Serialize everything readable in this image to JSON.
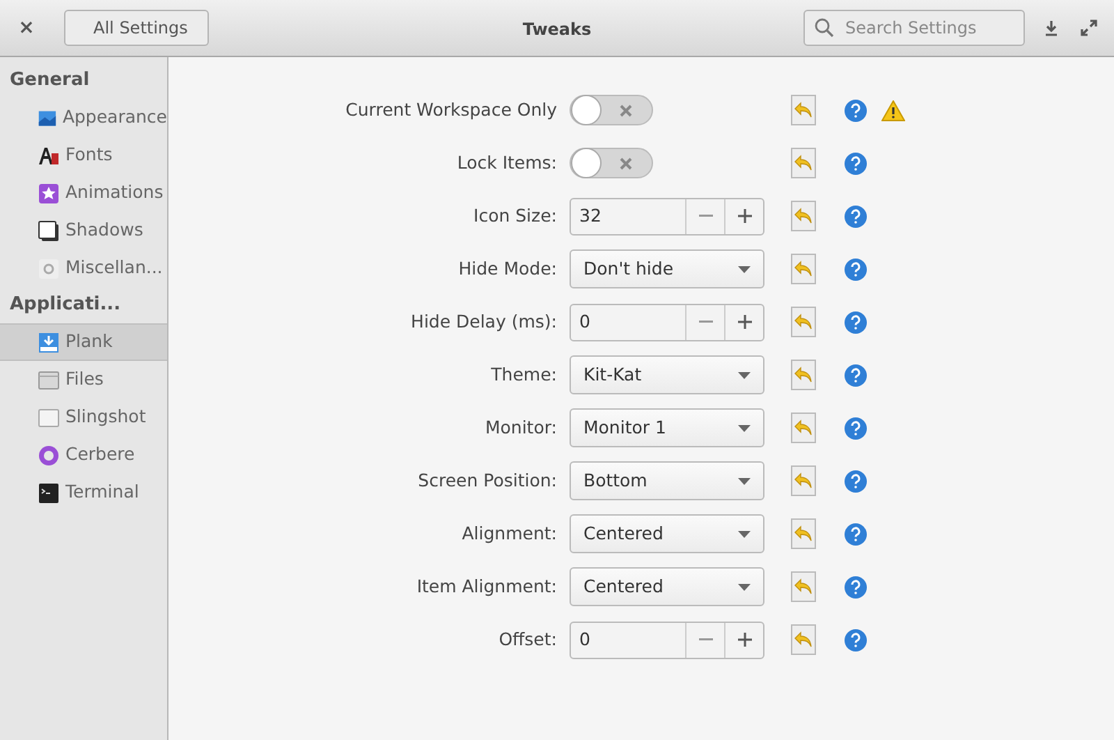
{
  "window": {
    "title": "Tweaks",
    "back_button": "All Settings",
    "close": "×",
    "search": {
      "placeholder": "Search Settings"
    }
  },
  "sidebar": {
    "sections": [
      {
        "heading": "General",
        "items": [
          {
            "label": "Appearance",
            "selected": false
          },
          {
            "label": "Fonts",
            "selected": false
          },
          {
            "label": "Animations",
            "selected": false
          },
          {
            "label": "Shadows",
            "selected": false
          },
          {
            "label": "Miscellan...",
            "selected": false
          }
        ]
      },
      {
        "heading": "Applicati...",
        "items": [
          {
            "label": "Plank",
            "selected": true
          },
          {
            "label": "Files",
            "selected": false
          },
          {
            "label": "Slingshot",
            "selected": false
          },
          {
            "label": "Cerbere",
            "selected": false
          },
          {
            "label": "Terminal",
            "selected": false
          }
        ]
      }
    ]
  },
  "settings": [
    {
      "kind": "switch",
      "label": "Current Workspace Only",
      "on": false,
      "warning": true
    },
    {
      "kind": "switch",
      "label": "Lock Items:",
      "on": false,
      "warning": false
    },
    {
      "kind": "spin",
      "label": "Icon Size:",
      "value": "32",
      "warning": false
    },
    {
      "kind": "combo",
      "label": "Hide Mode:",
      "value": "Don't hide",
      "warning": false
    },
    {
      "kind": "spin",
      "label": "Hide Delay (ms):",
      "value": "0",
      "warning": false
    },
    {
      "kind": "combo",
      "label": "Theme:",
      "value": "Kit-Kat",
      "warning": false
    },
    {
      "kind": "combo",
      "label": "Monitor:",
      "value": "Monitor 1",
      "warning": false
    },
    {
      "kind": "combo",
      "label": "Screen Position:",
      "value": "Bottom",
      "warning": false
    },
    {
      "kind": "combo",
      "label": "Alignment:",
      "value": "Centered",
      "warning": false
    },
    {
      "kind": "combo",
      "label": "Item Alignment:",
      "value": "Centered",
      "warning": false
    },
    {
      "kind": "spin",
      "label": "Offset:",
      "value": "0",
      "warning": false
    }
  ]
}
